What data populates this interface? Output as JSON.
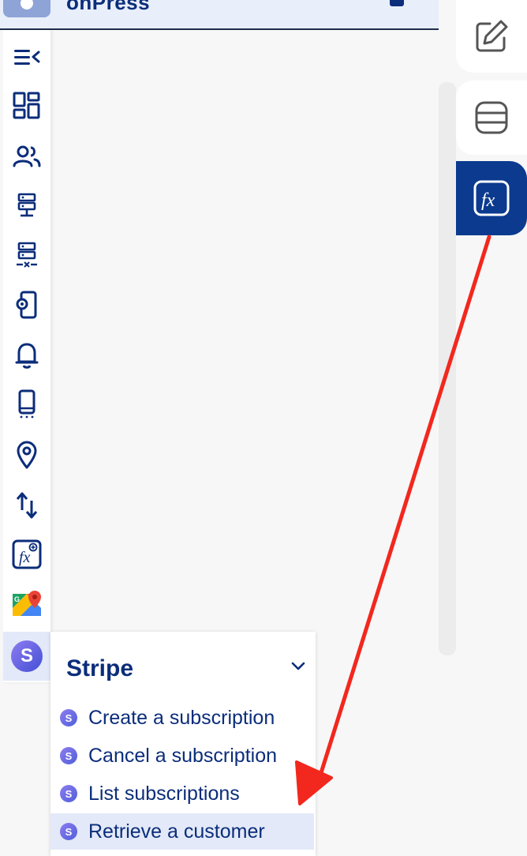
{
  "header": {
    "title": "onPress"
  },
  "rail": {
    "items": [
      {
        "icon": "collapse-menu-icon"
      },
      {
        "icon": "dashboard-icon"
      },
      {
        "icon": "users-icon"
      },
      {
        "icon": "server-icon"
      },
      {
        "icon": "server-disconnected-icon"
      },
      {
        "icon": "device-settings-icon"
      },
      {
        "icon": "bell-icon"
      },
      {
        "icon": "mobile-device-icon"
      },
      {
        "icon": "location-pin-icon"
      },
      {
        "icon": "transfer-arrows-icon"
      },
      {
        "icon": "function-add-icon"
      },
      {
        "icon": "google-maps-icon"
      },
      {
        "icon": "stripe-icon"
      }
    ]
  },
  "right_panel": {
    "tabs": [
      {
        "icon": "edit-icon"
      },
      {
        "icon": "database-icon"
      },
      {
        "icon": "function-icon"
      }
    ]
  },
  "stripe_menu": {
    "title": "Stripe",
    "items": [
      {
        "label": "Create a subscription"
      },
      {
        "label": "Cancel a subscription"
      },
      {
        "label": "List subscriptions"
      },
      {
        "label": "Retrieve a customer"
      }
    ],
    "logo_letter": "S"
  },
  "colors": {
    "brand": "#0b2d7a",
    "active_tab": "#0b3a8f",
    "selected_bg": "#e3e9f8",
    "annotation_arrow": "#f2281e"
  }
}
